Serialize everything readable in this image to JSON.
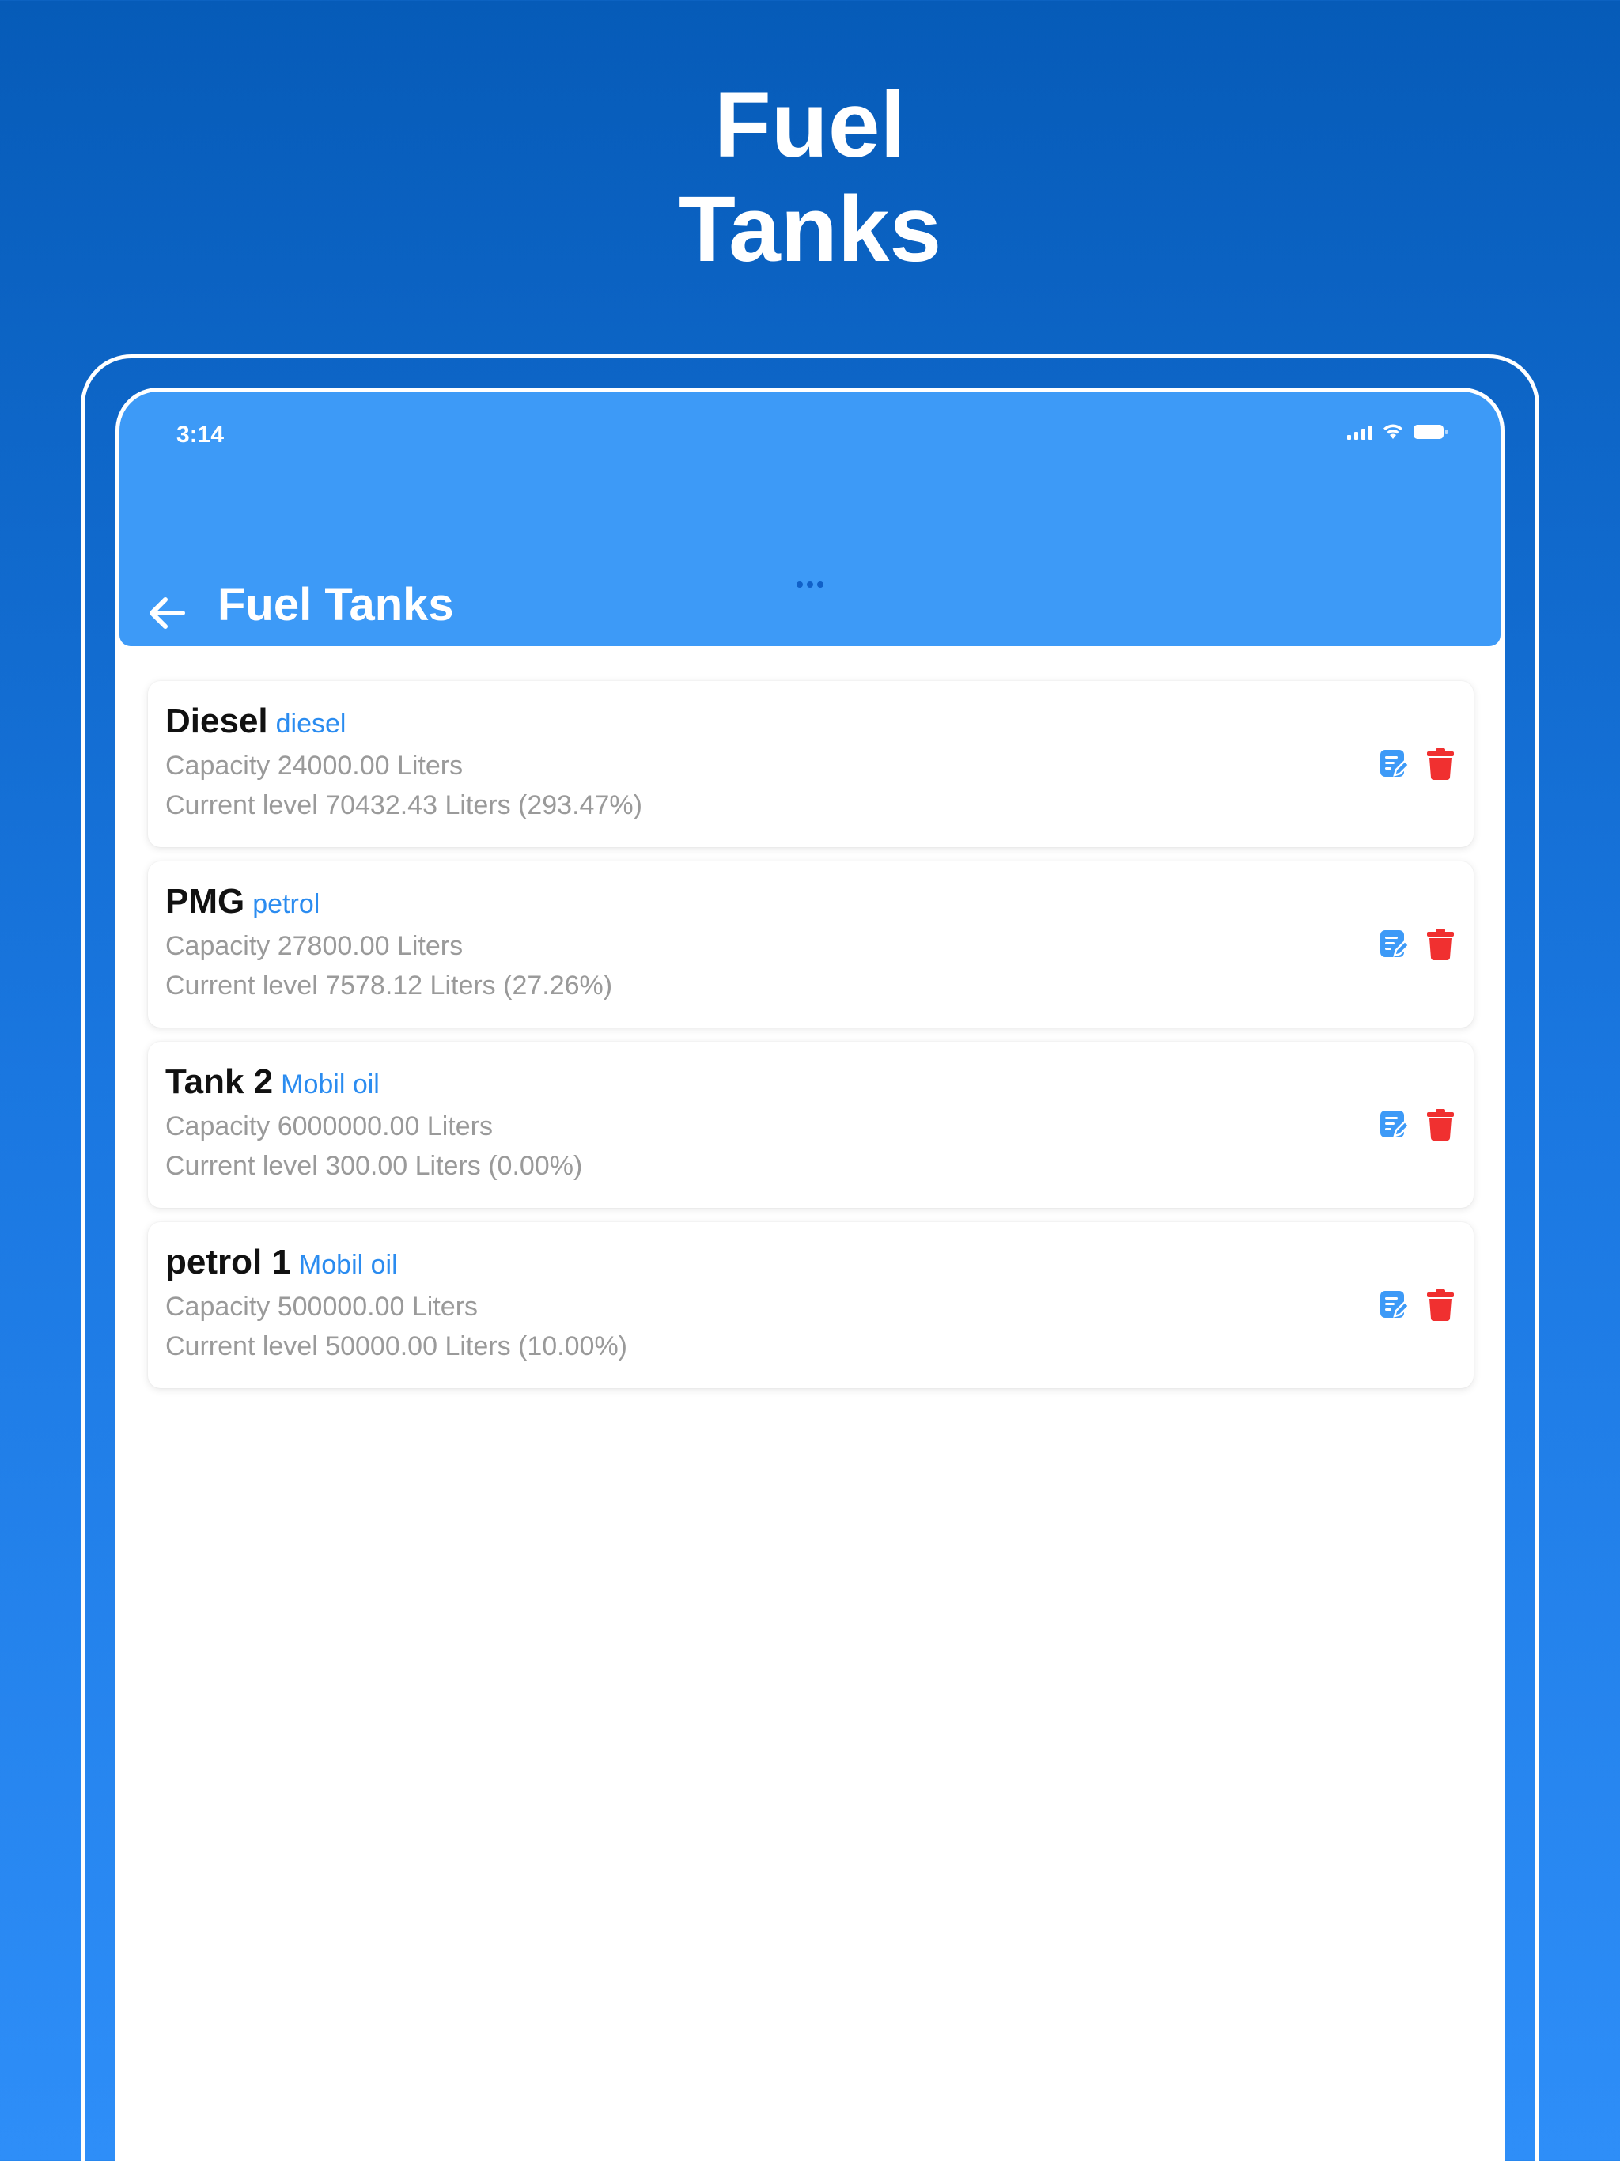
{
  "hero": {
    "title_line1": "Fuel",
    "title_line2": "Tanks"
  },
  "status_bar": {
    "time": "3:14",
    "icons": [
      "signal-icon",
      "wifi-icon",
      "battery-icon"
    ]
  },
  "appbar": {
    "title": "Fuel Tanks",
    "back_icon": "arrow-left-icon"
  },
  "colors": {
    "appbar": "#3d9af7",
    "accent": "#2b8cf0",
    "delete": "#f03030",
    "background_top": "#065bb8",
    "background_bottom": "#2e8ef8"
  },
  "tanks": [
    {
      "name": "Diesel",
      "type": "diesel",
      "capacity": "Capacity 24000.00 Liters",
      "level": "Current level 70432.43 Liters (293.47%)"
    },
    {
      "name": "PMG",
      "type": "petrol",
      "capacity": "Capacity 27800.00 Liters",
      "level": "Current level 7578.12 Liters (27.26%)"
    },
    {
      "name": "Tank 2",
      "type": "Mobil oil",
      "capacity": "Capacity 6000000.00 Liters",
      "level": "Current level 300.00 Liters (0.00%)"
    },
    {
      "name": "petrol 1",
      "type": "Mobil oil",
      "capacity": "Capacity 500000.00 Liters",
      "level": "Current level 50000.00 Liters (10.00%)"
    }
  ]
}
